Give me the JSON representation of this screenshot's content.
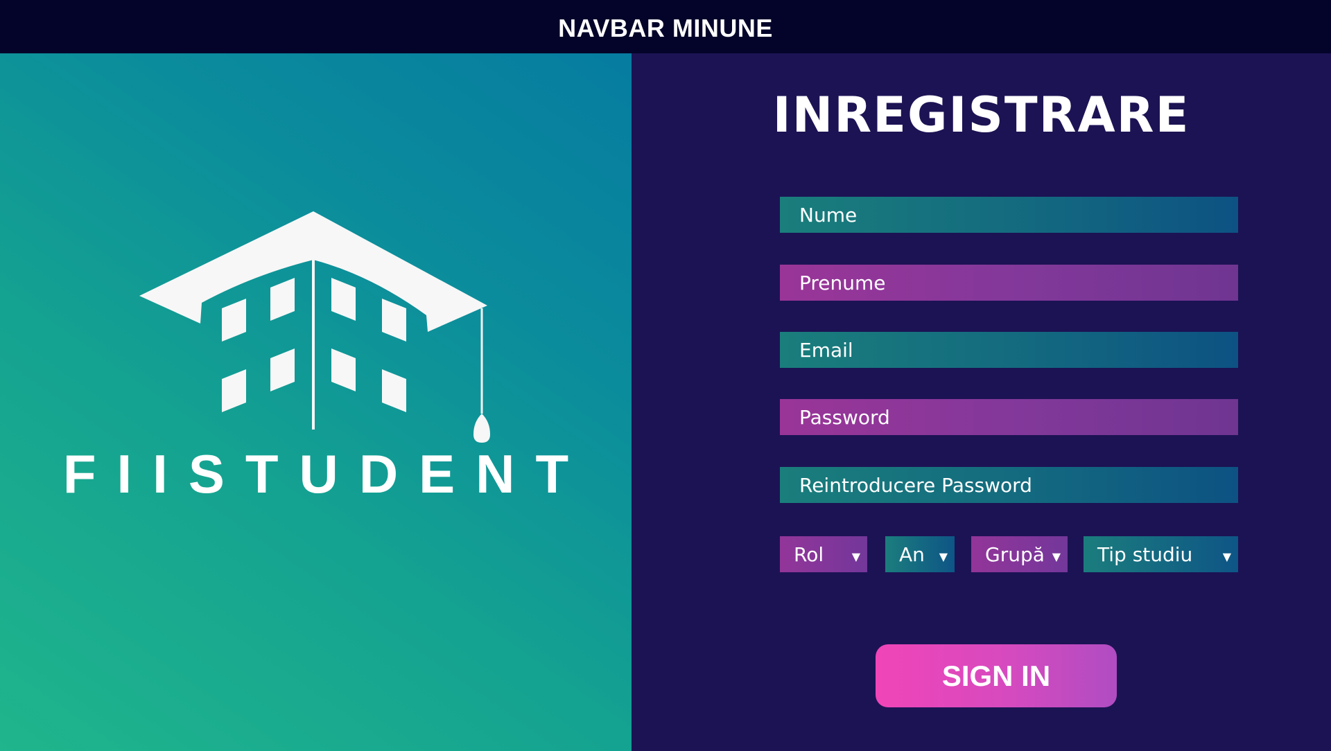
{
  "navbar": {
    "title": "NAVBAR MINUNE"
  },
  "brand": {
    "name": "FIISTUDENT"
  },
  "form": {
    "title": "INREGISTRARE",
    "fields": {
      "nume": "Nume",
      "prenume": "Prenume",
      "email": "Email",
      "password": "Password",
      "confirm_password": "Reintroducere Password"
    },
    "selects": {
      "rol": "Rol",
      "an": "An",
      "grupa": "Grupă",
      "tip_studiu": "Tip studiu"
    },
    "submit_label": "SIGN IN"
  },
  "colors": {
    "navbar_bg": "#04042a",
    "panel_bg": "#1c1354",
    "teal_accent": "#1a7e7c",
    "purple_accent": "#9a3598",
    "button_pink": "#f045b8"
  },
  "icons": {
    "logo": "graduation-cap-building-icon",
    "dropdown": "triangle-down-icon"
  }
}
